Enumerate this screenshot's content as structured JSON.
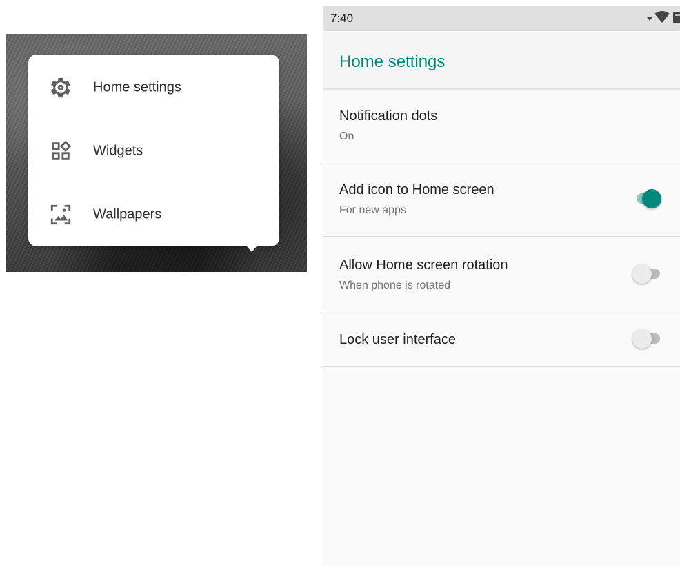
{
  "popup": {
    "items": [
      {
        "label": "Home settings",
        "icon": "gear-icon"
      },
      {
        "label": "Widgets",
        "icon": "widgets-icon"
      },
      {
        "label": "Wallpapers",
        "icon": "wallpaper-icon"
      }
    ]
  },
  "status_bar": {
    "time": "7:40",
    "icons": [
      "signal-arrow-icon",
      "wifi-icon",
      "battery-icon"
    ]
  },
  "app_bar": {
    "title": "Home settings"
  },
  "settings": [
    {
      "title": "Notification dots",
      "subtitle": "On"
    },
    {
      "title": "Add icon to Home screen",
      "subtitle": "For new apps",
      "toggle": true
    },
    {
      "title": "Allow Home screen rotation",
      "subtitle": "When phone is rotated",
      "toggle": false
    },
    {
      "title": "Lock user interface",
      "toggle": false
    }
  ],
  "colors": {
    "accent": "#00897b",
    "accent_track": "#80cbc4",
    "title_text": "#212121",
    "subtitle_text": "#737373"
  }
}
